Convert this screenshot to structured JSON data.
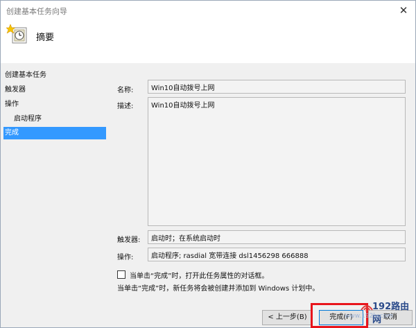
{
  "window": {
    "title": "创建基本任务向导",
    "close_glyph": "✕"
  },
  "header": {
    "title": "摘要"
  },
  "sidebar": {
    "items": [
      {
        "label": "创建基本任务"
      },
      {
        "label": "触发器"
      },
      {
        "label": "操作"
      },
      {
        "label": "启动程序"
      },
      {
        "label": "完成"
      }
    ],
    "active_index": 4
  },
  "form": {
    "name_label": "名称:",
    "name_value": "Win10自动拨号上网",
    "desc_label": "描述:",
    "desc_value": "Win10自动拨号上网",
    "trigger_label": "触发器:",
    "trigger_value": "启动时；在系统启动时",
    "action_label": "操作:",
    "action_value": "启动程序; rasdial 宽带连接 dsl1456298 666888"
  },
  "options": {
    "open_properties_label": "当单击“完成”时，打开此任务属性的对话框。",
    "open_properties_checked": false,
    "info_text": "当单击“完成”时，新任务将会被创建并添加到 Windows 计划中。"
  },
  "buttons": {
    "back_label": "< 上一步(B)",
    "finish_label": "完成(F)",
    "cancel_label": "取消"
  },
  "watermark": {
    "brand": "192路由网",
    "url": "www.192ly.com"
  },
  "colors": {
    "selection": "#3399ff",
    "highlight_box": "#e8141b",
    "primary_border": "#0078d7"
  }
}
